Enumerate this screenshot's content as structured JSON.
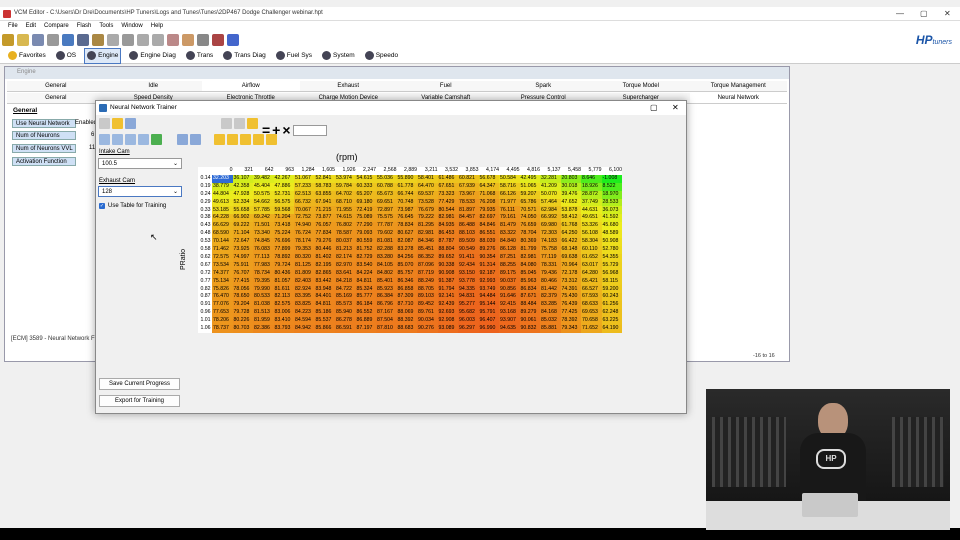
{
  "window": {
    "title": "VCM Editor - C:\\Users\\Dr Dre\\Documents\\HP Tuners\\Logs and Tunes\\Tunes\\2DP467 Dodge Challenger webinar.hpt"
  },
  "menu": [
    "File",
    "Edit",
    "Compare",
    "Flash",
    "Tools",
    "Window",
    "Help"
  ],
  "modules": [
    "Favorites",
    "OS",
    "Engine",
    "Engine Diag",
    "Trans",
    "Trans Diag",
    "Fuel Sys",
    "System",
    "Speedo"
  ],
  "logo": {
    "brand": "HP",
    "sub": "tuners"
  },
  "engine": {
    "title": "Engine",
    "tabs1": [
      "General",
      "Idle",
      "Airflow",
      "Exhaust",
      "Fuel",
      "Spark",
      "Torque Model",
      "Torque Management"
    ],
    "tabs2": [
      "General",
      "Speed Density",
      "Electronic Throttle",
      "Charge Motion Device",
      "Variable Camshaft",
      "Pressure Control",
      "Supercharger",
      "Neural Network"
    ],
    "general": "General",
    "left": [
      "Use Neural Network",
      "Num of Neurons",
      "Num of Neurons VVL",
      "Activation Function"
    ],
    "left_values": [
      "Enabled",
      "6",
      "11"
    ],
    "status": "[ECM] 3589 - Neural Network Fir",
    "scroll": "-16 to 16"
  },
  "nn": {
    "title": "Neural Network Trainer",
    "intake_label": "Intake Cam",
    "intake_value": "100.5",
    "exhaust_label": "Exhaust Cam",
    "exhaust_value": "128",
    "checkbox": "Use Table for Training",
    "save": "Save Current Progress",
    "export": "Export for Training",
    "xaxis": "(rpm)",
    "yaxis": "PRatio"
  },
  "table": {
    "cols": [
      "0",
      "321",
      "642",
      "963",
      "1,284",
      "1,605",
      "1,926",
      "2,247",
      "2,568",
      "2,889",
      "3,211",
      "3,532",
      "3,853",
      "4,174",
      "4,495",
      "4,816",
      "5,137",
      "5,458",
      "5,779",
      "6,100"
    ],
    "rows": [
      "0.14",
      "0.19",
      "0.24",
      "0.29",
      "0.33",
      "0.38",
      "0.43",
      "0.48",
      "0.53",
      "0.58",
      "0.62",
      "0.67",
      "0.72",
      "0.77",
      "0.82",
      "0.87",
      "0.91",
      "0.96",
      "1.01",
      "1.06"
    ],
    "data": [
      [
        "32.203",
        "36.107",
        "39.482",
        "42.267",
        "51.067",
        "52.841",
        "53.974",
        "54.615",
        "55.036",
        "55.890",
        "58.401",
        "61.486",
        "60.821",
        "56.678",
        "50.584",
        "42.495",
        "32.281",
        "20.803",
        "8.646",
        "-1.008"
      ],
      [
        "38.779",
        "42.358",
        "45.404",
        "47.886",
        "57.233",
        "58.783",
        "59.784",
        "60.333",
        "60.788",
        "61.778",
        "64.470",
        "67.651",
        "67.939",
        "64.347",
        "58.716",
        "51.065",
        "41.209",
        "30.018",
        "18.926",
        "8.522"
      ],
      [
        "44.804",
        "47.928",
        "50.575",
        "52.731",
        "62.513",
        "63.855",
        "64.702",
        "65.207",
        "65.673",
        "66.744",
        "69.537",
        "73.323",
        "73.967",
        "71.068",
        "66.126",
        "59.207",
        "50.070",
        "39.476",
        "28.872",
        "18.970"
      ],
      [
        "49.613",
        "52.334",
        "54.662",
        "56.575",
        "66.732",
        "67.941",
        "68.710",
        "69.180",
        "69.651",
        "70.748",
        "73.528",
        "77.429",
        "78.533",
        "76.208",
        "71.977",
        "65.786",
        "57.464",
        "47.652",
        "37.749",
        "28.533"
      ],
      [
        "53.185",
        "55.658",
        "57.785",
        "59.568",
        "70.067",
        "71.215",
        "71.955",
        "72.419",
        "72.897",
        "73.987",
        "76.679",
        "80.544",
        "81.897",
        "79.935",
        "76.111",
        "70.571",
        "62.984",
        "53.878",
        "44.631",
        "36.073"
      ],
      [
        "64.228",
        "66.902",
        "69.242",
        "71.204",
        "72.752",
        "73.877",
        "74.615",
        "75.089",
        "75.575",
        "76.645",
        "79.222",
        "82.981",
        "84.457",
        "82.697",
        "79.161",
        "74.050",
        "66.992",
        "58.412",
        "49.651",
        "41.592"
      ],
      [
        "66.629",
        "69.222",
        "71.501",
        "73.418",
        "74.940",
        "76.057",
        "76.802",
        "77.290",
        "77.787",
        "78.834",
        "81.295",
        "84.935",
        "86.488",
        "84.846",
        "81.479",
        "76.659",
        "69.980",
        "61.768",
        "53.326",
        "45.680"
      ],
      [
        "68.590",
        "71.104",
        "73.340",
        "75.224",
        "76.724",
        "77.834",
        "78.587",
        "79.093",
        "79.602",
        "80.627",
        "82.981",
        "86.453",
        "88.103",
        "86.551",
        "83.322",
        "78.704",
        "72.303",
        "64.250",
        "56.108",
        "48.589"
      ],
      [
        "70.144",
        "72.647",
        "74.845",
        "76.696",
        "78.174",
        "79.276",
        "80.037",
        "80.559",
        "81.081",
        "82.087",
        "84.346",
        "87.787",
        "89.509",
        "88.039",
        "84.840",
        "80.369",
        "74.183",
        "66.422",
        "58.304",
        "50.908"
      ],
      [
        "71.462",
        "73.925",
        "76.083",
        "77.899",
        "79.353",
        "80.446",
        "81.213",
        "81.752",
        "82.288",
        "83.278",
        "85.451",
        "88.804",
        "90.549",
        "89.276",
        "86.128",
        "81.799",
        "75.758",
        "68.148",
        "60.110",
        "52.780"
      ],
      [
        "72.575",
        "74.997",
        "77.113",
        "78.892",
        "80.320",
        "81.402",
        "82.174",
        "82.729",
        "83.280",
        "84.256",
        "86.352",
        "89.652",
        "91.411",
        "90.354",
        "87.251",
        "82.981",
        "77.119",
        "69.638",
        "61.652",
        "54.355"
      ],
      [
        "73.534",
        "75.911",
        "77.983",
        "79.724",
        "81.125",
        "82.195",
        "82.970",
        "83.540",
        "84.105",
        "85.070",
        "87.096",
        "90.338",
        "92.434",
        "91.314",
        "88.255",
        "84.080",
        "78.331",
        "70.964",
        "63.017",
        "55.729"
      ],
      [
        "74.377",
        "76.707",
        "78.734",
        "80.436",
        "81.809",
        "82.865",
        "83.641",
        "84.224",
        "84.802",
        "85.757",
        "87.719",
        "90.908",
        "93.150",
        "92.187",
        "89.175",
        "85.045",
        "79.436",
        "72.178",
        "64.280",
        "56.968"
      ],
      [
        "75.134",
        "77.415",
        "79.395",
        "81.057",
        "82.403",
        "83.442",
        "84.218",
        "84.811",
        "85.401",
        "86.346",
        "88.249",
        "91.387",
        "93.778",
        "92.993",
        "90.037",
        "85.963",
        "80.466",
        "73.312",
        "65.421",
        "58.115"
      ],
      [
        "75.826",
        "78.056",
        "79.990",
        "81.611",
        "82.924",
        "83.948",
        "84.722",
        "85.324",
        "85.923",
        "86.858",
        "88.705",
        "91.794",
        "94.335",
        "93.749",
        "90.856",
        "86.834",
        "81.442",
        "74.391",
        "66.527",
        "59.200"
      ],
      [
        "76.470",
        "78.650",
        "80.533",
        "82.113",
        "83.395",
        "84.401",
        "85.169",
        "85.777",
        "86.384",
        "87.309",
        "89.103",
        "92.141",
        "94.831",
        "94.484",
        "91.646",
        "87.671",
        "82.379",
        "75.430",
        "67.593",
        "60.243"
      ],
      [
        "77.076",
        "79.204",
        "81.038",
        "82.575",
        "83.825",
        "84.811",
        "85.573",
        "86.184",
        "86.796",
        "87.710",
        "89.452",
        "92.439",
        "95.277",
        "95.144",
        "92.415",
        "88.484",
        "83.285",
        "76.439",
        "68.633",
        "61.256"
      ],
      [
        "77.653",
        "79.728",
        "81.513",
        "83.006",
        "84.223",
        "85.186",
        "85.940",
        "86.552",
        "87.167",
        "88.069",
        "89.761",
        "92.693",
        "95.682",
        "95.791",
        "93.168",
        "89.279",
        "84.168",
        "77.425",
        "69.653",
        "62.248"
      ],
      [
        "78.206",
        "80.226",
        "81.959",
        "83.410",
        "84.594",
        "85.537",
        "86.278",
        "86.889",
        "87.504",
        "88.392",
        "90.034",
        "92.908",
        "96.003",
        "96.407",
        "93.907",
        "90.061",
        "85.032",
        "78.392",
        "70.658",
        "63.225"
      ],
      [
        "78.737",
        "80.703",
        "82.386",
        "83.793",
        "84.942",
        "85.866",
        "86.591",
        "87.197",
        "87.810",
        "88.683",
        "90.276",
        "93.089",
        "96.297",
        "96.990",
        "94.635",
        "90.832",
        "85.881",
        "79.343",
        "71.652",
        "64.190"
      ]
    ]
  }
}
